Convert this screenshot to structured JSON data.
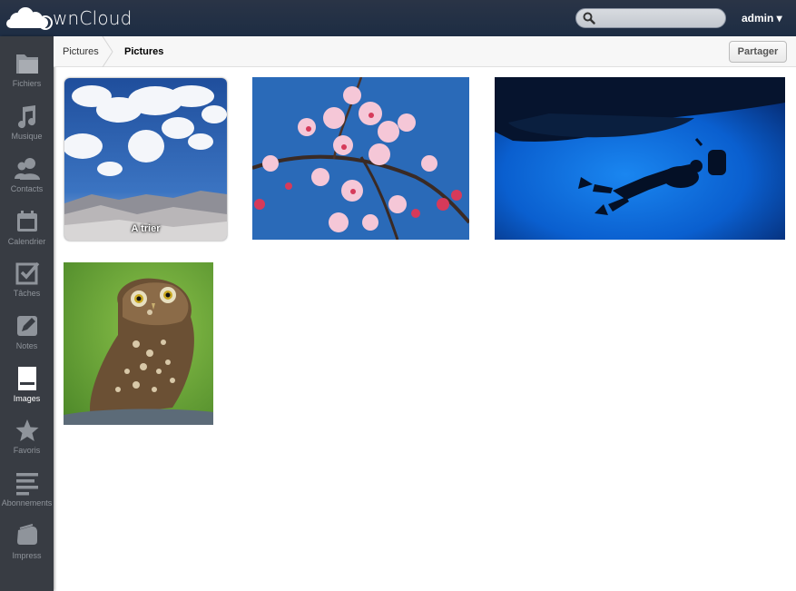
{
  "header": {
    "logo_text": "wnCloud",
    "search_placeholder": "",
    "user_label": "admin ▾"
  },
  "nav": [
    {
      "label": "Fichiers",
      "icon": "folder-icon"
    },
    {
      "label": "Musique",
      "icon": "music-icon"
    },
    {
      "label": "Contacts",
      "icon": "contacts-icon"
    },
    {
      "label": "Calendrier",
      "icon": "calendar-icon"
    },
    {
      "label": "Tâches",
      "icon": "tasks-icon"
    },
    {
      "label": "Notes",
      "icon": "notes-icon"
    },
    {
      "label": "Images",
      "icon": "images-icon",
      "active": true
    },
    {
      "label": "Favoris",
      "icon": "star-icon"
    },
    {
      "label": "Abonnements",
      "icon": "feed-icon"
    },
    {
      "label": "Impress",
      "icon": "impress-icon"
    }
  ],
  "breadcrumb": {
    "root": "Pictures",
    "current": "Pictures"
  },
  "share_label": "Partager",
  "gallery": {
    "album_label": "A trier",
    "images": [
      "cherry-blossom-image",
      "scuba-diver-image",
      "owl-image"
    ]
  },
  "colors": {
    "header": "#1d2d44",
    "sidebar": "#383c43",
    "sidebar_text": "#8f949b",
    "active_text": "#ffffff"
  }
}
